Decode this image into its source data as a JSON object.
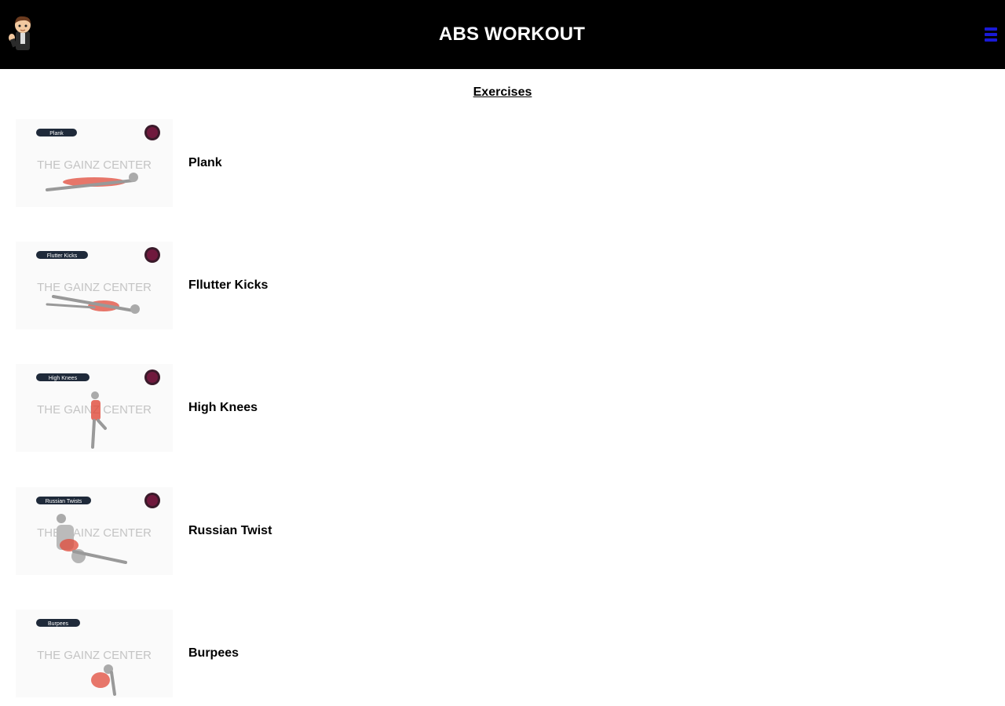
{
  "header": {
    "title": "ABS WORKOUT",
    "logo_icon": "avatar-waving-icon",
    "menu_icon": "hamburger-menu-icon",
    "bg_color": "#000000",
    "menu_color": "#1a1ad6"
  },
  "main": {
    "section_title": "Exercises",
    "exercises": [
      {
        "label": "Plank",
        "thumb_tag": "Plank",
        "watermark": "THE GAINZ CENTER"
      },
      {
        "label": "Fllutter Kicks",
        "thumb_tag": "Flutter Kicks",
        "watermark": "THE GAINZ CENTER"
      },
      {
        "label": "High Knees",
        "thumb_tag": "High Knees",
        "watermark": "THE GAINZ CENTER"
      },
      {
        "label": "Russian Twist",
        "thumb_tag": "Russian Twists",
        "watermark": "THE GAINZ CENTER"
      },
      {
        "label": "Burpees",
        "thumb_tag": "Burpees",
        "watermark": "THE GAINZ CENTER"
      }
    ]
  }
}
